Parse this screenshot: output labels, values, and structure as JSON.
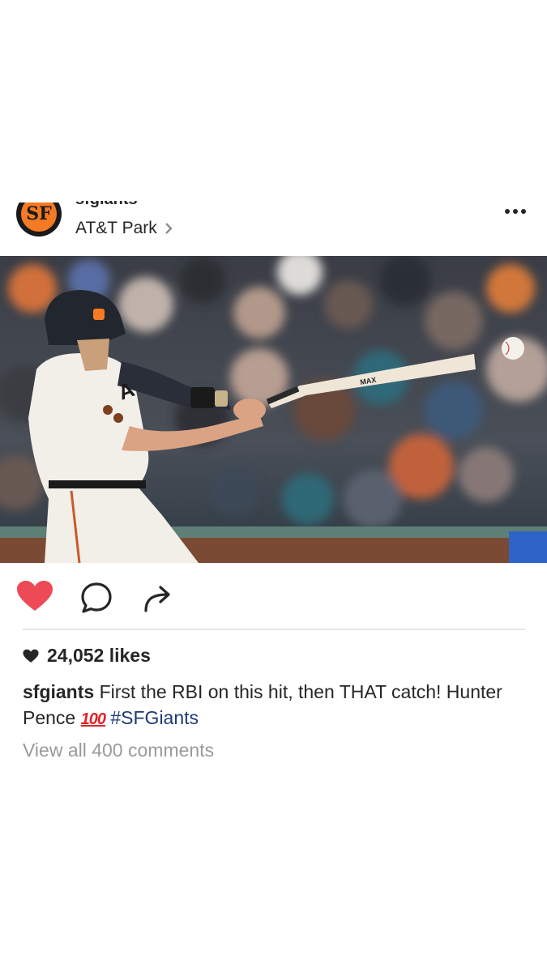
{
  "post": {
    "username": "sfgiants",
    "location": "AT&T Park",
    "avatar_logo_text": "SF",
    "more_label": "more options",
    "photo_alt": "baseball player swinging bat at ball",
    "bat_brand": "MAX",
    "jersey_text": "A"
  },
  "engagement": {
    "likes": "24,052 likes",
    "view_comments": "View all 400 comments"
  },
  "caption": {
    "username": "sfgiants",
    "text": " First the RBI on this hit, then THAT catch! Hunter Pence ",
    "emoji": "100",
    "hashtag": "#SFGiants"
  },
  "colors": {
    "like_red": "#ed4956",
    "hashtag_blue": "#1e3a72",
    "giants_orange": "#f47a24",
    "muted_gray": "#9a9a9a"
  }
}
